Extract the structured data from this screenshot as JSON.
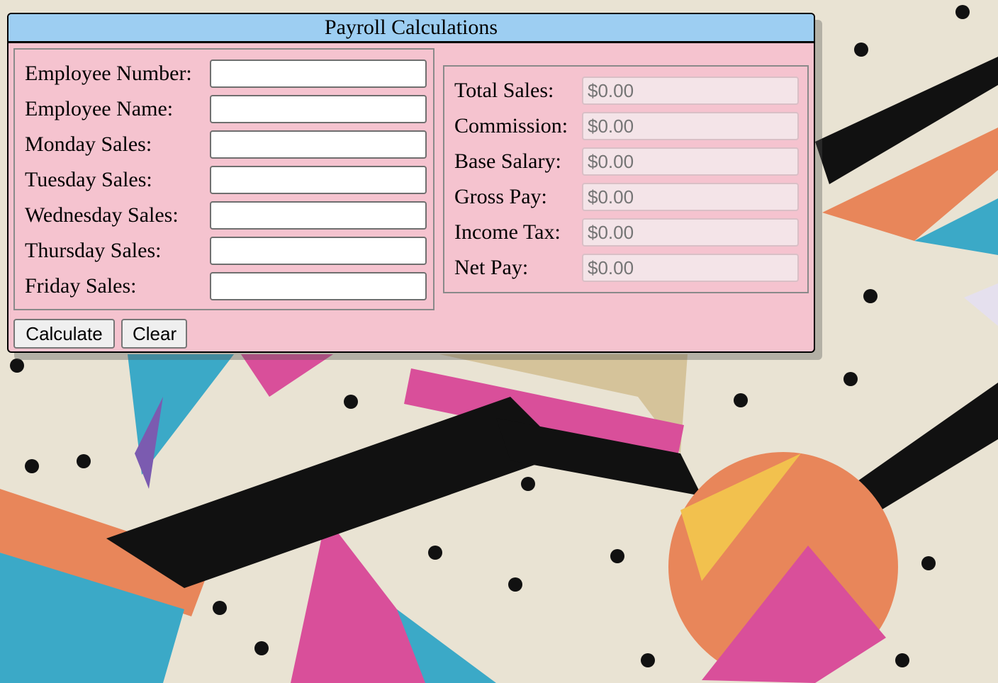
{
  "window": {
    "title": "Payroll Calculations"
  },
  "inputs": [
    {
      "label": "Employee Number:",
      "value": ""
    },
    {
      "label": "Employee Name:",
      "value": ""
    },
    {
      "label": "Monday Sales:",
      "value": ""
    },
    {
      "label": "Tuesday Sales:",
      "value": ""
    },
    {
      "label": "Wednesday Sales:",
      "value": ""
    },
    {
      "label": "Thursday Sales:",
      "value": ""
    },
    {
      "label": "Friday Sales:",
      "value": ""
    }
  ],
  "outputs": [
    {
      "label": "Total Sales:",
      "value": "$0.00"
    },
    {
      "label": "Commission:",
      "value": "$0.00"
    },
    {
      "label": "Base Salary:",
      "value": "$0.00"
    },
    {
      "label": "Gross Pay:",
      "value": "$0.00"
    },
    {
      "label": "Income Tax:",
      "value": "$0.00"
    },
    {
      "label": "Net Pay:",
      "value": "$0.00"
    }
  ],
  "buttons": {
    "calculate": "Calculate",
    "clear": "Clear"
  },
  "colors": {
    "panel": "#f5c3cf",
    "title_bar": "#9dcef2",
    "readonly_field": "#f4e4e8"
  }
}
